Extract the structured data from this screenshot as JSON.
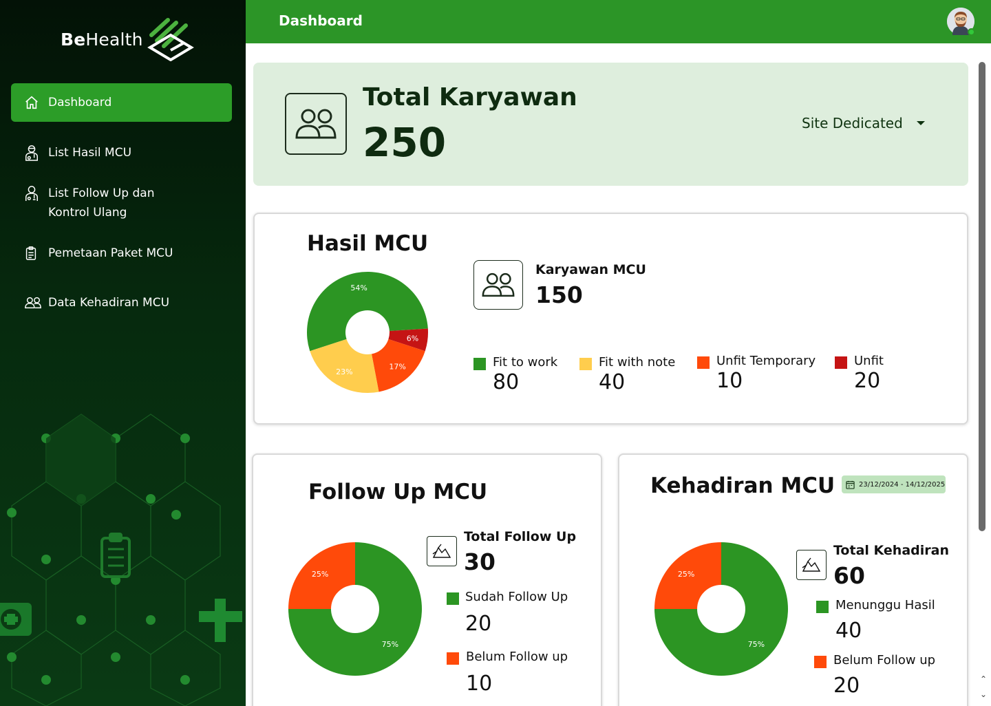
{
  "app": {
    "brand_part1": "Be",
    "brand_part2": "Health"
  },
  "header": {
    "title": "Dashboard"
  },
  "sidebar": {
    "items": [
      {
        "label": "Dashboard",
        "icon": "home-icon",
        "active": true
      },
      {
        "label": "List Hasil MCU",
        "icon": "doctor-icon"
      },
      {
        "label": "List Follow Up dan Kontrol Ulang",
        "icon": "doctor-icon"
      },
      {
        "label": "Pemetaan Paket MCU",
        "icon": "clipboard-icon"
      },
      {
        "label": "Data Kehadiran MCU",
        "icon": "users-icon"
      }
    ]
  },
  "total": {
    "title": "Total Karyawan",
    "value": "250",
    "site_filter": "Site Dedicated"
  },
  "hasil": {
    "title": "Hasil MCU",
    "kpi_label": "Karyawan MCU",
    "kpi_value": "150",
    "legend": [
      {
        "label": "Fit to work",
        "value": "80",
        "color": "#2c9523"
      },
      {
        "label": "Fit with note",
        "value": "40",
        "color": "#ffcd4d"
      },
      {
        "label": "Unfit Temporary",
        "value": "10",
        "color": "#ff4a0a"
      },
      {
        "label": "Unfit",
        "value": "20",
        "color": "#c51414"
      }
    ]
  },
  "followup": {
    "title": "Follow Up  MCU",
    "kpi_label": "Total Follow  Up",
    "kpi_value": "30",
    "legend": [
      {
        "label": "Sudah  Follow Up",
        "value": "20",
        "color": "#2c9523"
      },
      {
        "label": "Belum Follow up",
        "value": "10",
        "color": "#ff4a0a"
      }
    ]
  },
  "kehadiran": {
    "title": "Kehadiran  MCU",
    "date_range": "23/12/2024 - 14/12/2025",
    "kpi_label": "Total Kehadiran",
    "kpi_value": "60",
    "legend": [
      {
        "label": "Menunggu Hasil",
        "value": "40",
        "color": "#2c9523"
      },
      {
        "label": "Belum Follow up",
        "value": "20",
        "color": "#ff4a0a"
      }
    ]
  },
  "chart_data": [
    {
      "type": "pie",
      "title": "Hasil MCU",
      "categories": [
        "Fit to work",
        "Unfit",
        "Unfit Temporary",
        "Fit with note"
      ],
      "values": [
        54,
        6,
        17,
        23
      ],
      "labels": [
        "54%",
        "6%",
        "17%",
        "23%"
      ],
      "colors": [
        "#2c9523",
        "#c51414",
        "#ff4a0a",
        "#ffcd4d"
      ],
      "donut": true
    },
    {
      "type": "pie",
      "title": "Follow Up  MCU",
      "categories": [
        "Sudah  Follow Up",
        "Belum Follow up"
      ],
      "values": [
        75,
        25
      ],
      "labels": [
        "75%",
        "25%"
      ],
      "colors": [
        "#2c9523",
        "#ff4a0a"
      ],
      "donut": true
    },
    {
      "type": "pie",
      "title": "Kehadiran  MCU",
      "categories": [
        "Menunggu Hasil",
        "Belum Follow up"
      ],
      "values": [
        75,
        25
      ],
      "labels": [
        "75%",
        "25%"
      ],
      "colors": [
        "#2c9523",
        "#ff4a0a"
      ],
      "donut": true
    }
  ]
}
